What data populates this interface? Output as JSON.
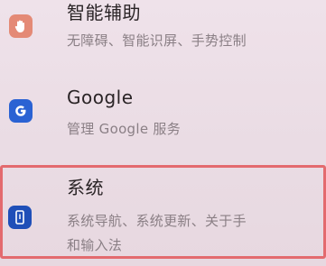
{
  "settings": {
    "items": [
      {
        "title": "智能辅助",
        "subtitle": "无障碍、智能识屏、手势控制",
        "icon": "hand-icon",
        "icon_color": "#e48a76"
      },
      {
        "title": "Google",
        "subtitle": "管理 Google 服务",
        "icon": "google-g-icon",
        "icon_color": "#2a62d3"
      },
      {
        "title": "系统",
        "subtitle_line1": "系统导航、系统更新、关于手",
        "subtitle_line2": "和输入法",
        "icon": "phone-icon",
        "icon_color": "#1f4fb8",
        "highlight_color": "#e36a6e"
      }
    ]
  }
}
